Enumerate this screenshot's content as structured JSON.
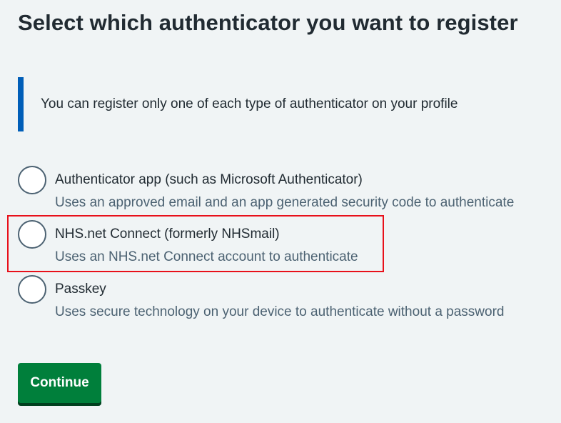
{
  "page": {
    "title": "Select which authenticator you want to register"
  },
  "inset": {
    "text": "You can register only one of each type of authenticator on your profile"
  },
  "options": [
    {
      "label": "Authenticator app (such as Microsoft Authenticator)",
      "hint": "Uses an approved email and an app generated security code to authenticate",
      "selected": false
    },
    {
      "label": "NHS.net Connect (formerly NHSmail)",
      "hint": "Uses an NHS.net Connect account to authenticate",
      "selected": false,
      "highlighted": true
    },
    {
      "label": "Passkey",
      "hint": "Uses secure technology on your device to authenticate without a password",
      "selected": false
    }
  ],
  "actions": {
    "continue_label": "Continue"
  },
  "colors": {
    "background": "#f0f4f5",
    "text": "#212b32",
    "secondary_text": "#4c6272",
    "inset_border": "#005eb8",
    "button": "#007f3b",
    "button_shadow": "#00401e",
    "highlight": "#e8101a"
  }
}
